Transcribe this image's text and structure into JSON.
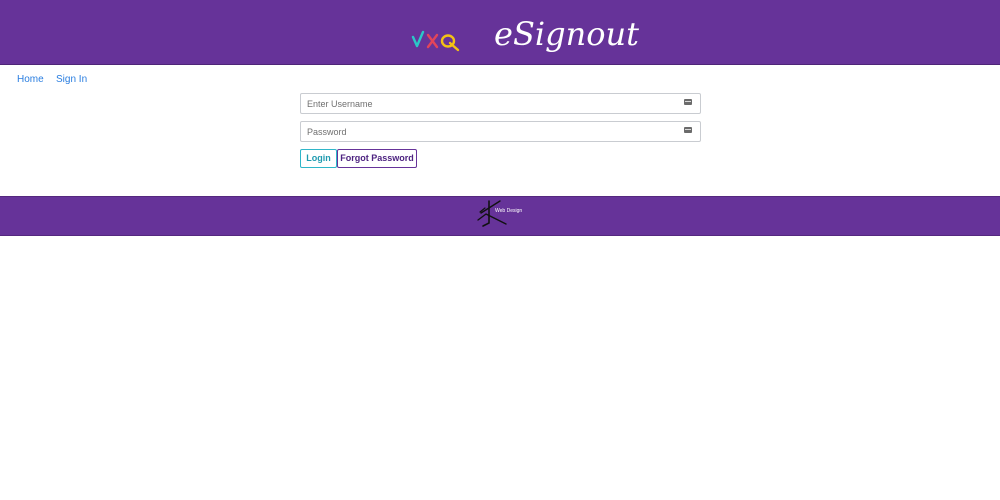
{
  "header": {
    "brand_name": "eSignout",
    "logo_marks": "check-x-q-icon"
  },
  "nav": {
    "items": [
      {
        "label": "Home"
      },
      {
        "label": "Sign In"
      }
    ]
  },
  "login_form": {
    "username": {
      "placeholder": "Enter Username",
      "value": ""
    },
    "password": {
      "placeholder": "Password",
      "value": ""
    },
    "login_label": "Login",
    "forgot_label": "Forgot Password"
  },
  "footer": {
    "credit_text": "Web Design"
  },
  "colors": {
    "brand_purple": "#663399",
    "link_blue": "#2a7ee0",
    "login_teal": "#2fb6c9"
  }
}
